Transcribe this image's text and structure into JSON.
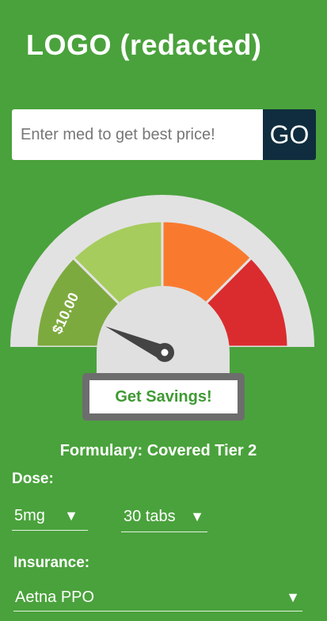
{
  "header": {
    "logo": "LOGO (redacted)"
  },
  "search": {
    "placeholder": "Enter med to get best price!",
    "button_label": "GO"
  },
  "gauge": {
    "segment_label": "$10.00",
    "colors": [
      "#7daa3e",
      "#a6cc5d",
      "#f97a2f",
      "#da2c2f"
    ],
    "track_color": "#e2e2e2",
    "hub_color": "#e0e0e0",
    "needle_color": "#444444"
  },
  "savings_button": {
    "label": "Get Savings!"
  },
  "formulary": {
    "text": "Formulary: Covered Tier 2"
  },
  "dose": {
    "label": "Dose:",
    "strength": {
      "value": "5mg",
      "arrow": "▼"
    },
    "quantity": {
      "value": "30 tabs",
      "arrow": "▼"
    }
  },
  "insurance": {
    "label": "Insurance:",
    "selected": "Aetna PPO",
    "arrow": "▼"
  },
  "colors": {
    "background": "#4aa23c",
    "go_button": "#0f2d3e",
    "accent_text": "#3f9a33"
  }
}
